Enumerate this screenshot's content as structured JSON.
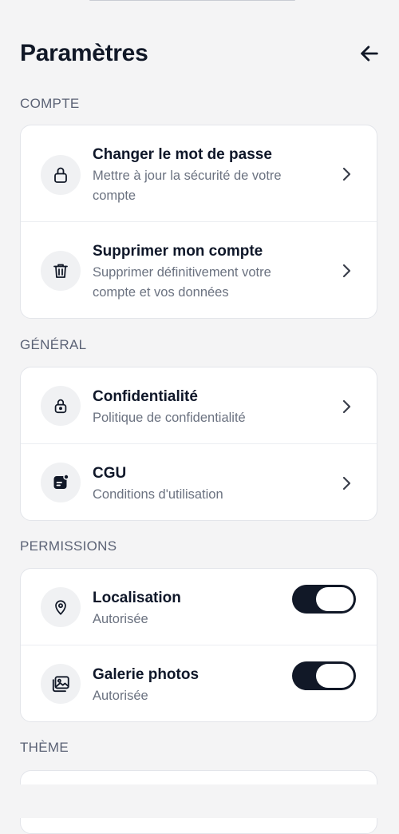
{
  "header": {
    "title": "Paramètres",
    "back_icon": "arrow-left-icon"
  },
  "sections": {
    "compte": {
      "label": "COMPTE",
      "items": [
        {
          "icon": "lock-icon",
          "title": "Changer le mot de passe",
          "subtitle": "Mettre à jour la sécurité de votre compte"
        },
        {
          "icon": "trash-icon",
          "title": "Supprimer mon compte",
          "subtitle": "Supprimer définitivement votre compte et vos données"
        }
      ]
    },
    "general": {
      "label": "GÉNÉRAL",
      "items": [
        {
          "icon": "lock-icon",
          "title": "Confidentialité",
          "subtitle": "Politique de confidentialité"
        },
        {
          "icon": "document-badge-icon",
          "title": "CGU",
          "subtitle": "Conditions d'utilisation"
        }
      ]
    },
    "permissions": {
      "label": "PERMISSIONS",
      "items": [
        {
          "icon": "map-pin-icon",
          "title": "Localisation",
          "subtitle": "Autorisée",
          "enabled": true
        },
        {
          "icon": "photo-gallery-icon",
          "title": "Galerie photos",
          "subtitle": "Autorisée",
          "enabled": true
        }
      ]
    },
    "theme": {
      "label": "THÈME"
    }
  },
  "colors": {
    "background": "#f4f4f5",
    "card": "#ffffff",
    "text_primary": "#0f1729",
    "text_secondary": "#6b7280",
    "toggle_on": "#111827"
  }
}
